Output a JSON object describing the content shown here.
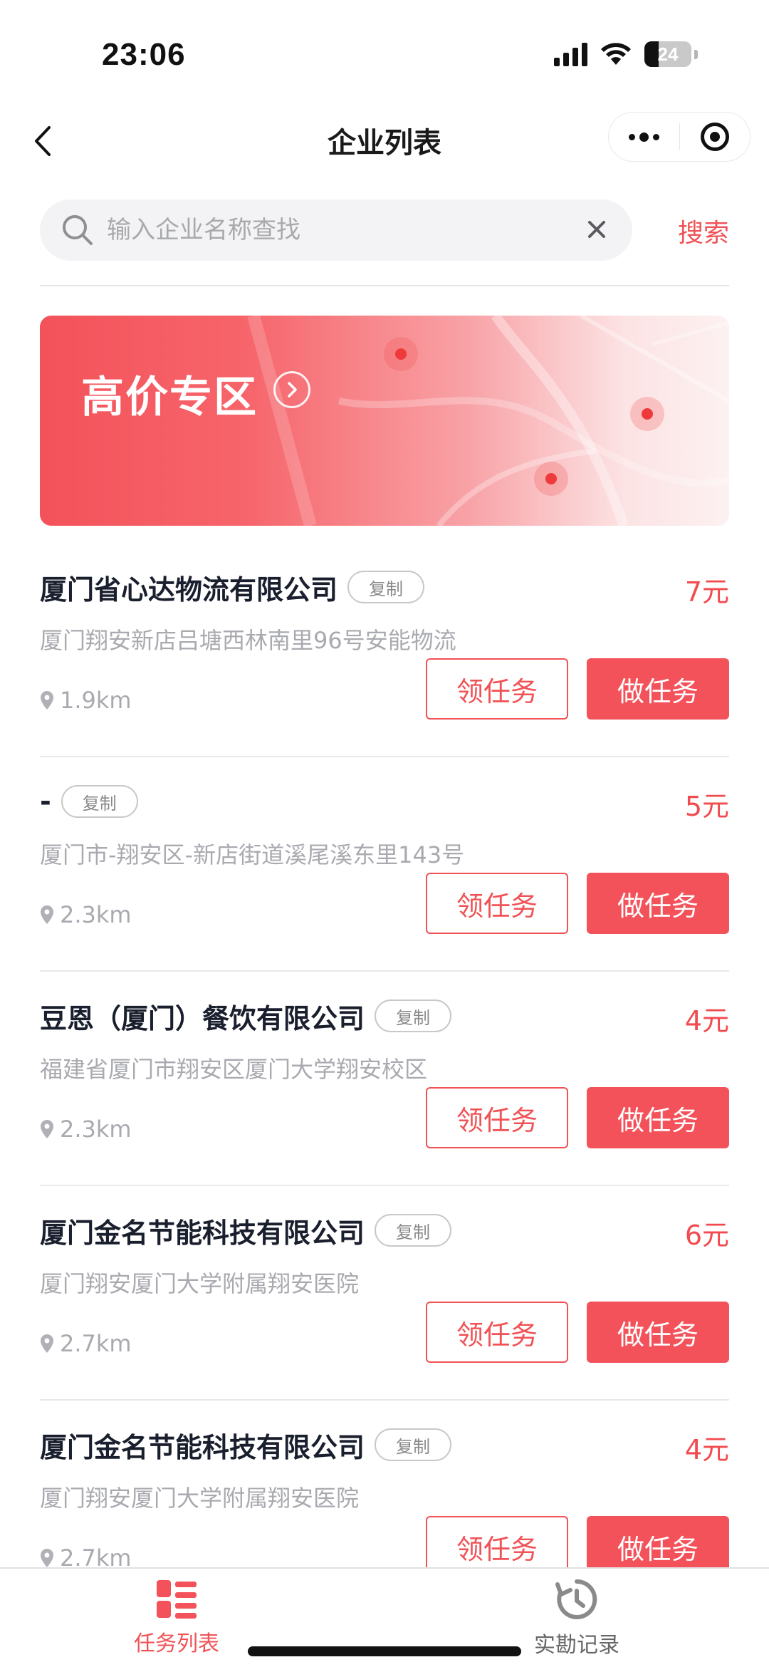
{
  "status_bar": {
    "time": "23:06",
    "battery": "24"
  },
  "nav": {
    "title": "企业列表"
  },
  "search": {
    "placeholder": "输入企业名称查找",
    "button_label": "搜索"
  },
  "banner": {
    "title": "高价专区"
  },
  "companies": [
    {
      "name": "厦门省心达物流有限公司",
      "copy_label": "复制",
      "price": "7元",
      "address": "厦门翔安新店吕塘西林南里96号安能物流",
      "distance": "1.9km",
      "claim_label": "领任务",
      "do_label": "做任务"
    },
    {
      "name": "-",
      "copy_label": "复制",
      "price": "5元",
      "address": "厦门市-翔安区-新店街道溪尾溪东里143号",
      "distance": "2.3km",
      "claim_label": "领任务",
      "do_label": "做任务"
    },
    {
      "name": "豆恩（厦门）餐饮有限公司",
      "copy_label": "复制",
      "price": "4元",
      "address": "福建省厦门市翔安区厦门大学翔安校区",
      "distance": "2.3km",
      "claim_label": "领任务",
      "do_label": "做任务"
    },
    {
      "name": "厦门金名节能科技有限公司",
      "copy_label": "复制",
      "price": "6元",
      "address": "厦门翔安厦门大学附属翔安医院",
      "distance": "2.7km",
      "claim_label": "领任务",
      "do_label": "做任务"
    },
    {
      "name": "厦门金名节能科技有限公司",
      "copy_label": "复制",
      "price": "4元",
      "address": "厦门翔安厦门大学附属翔安医院",
      "distance": "2.7km",
      "claim_label": "领任务",
      "do_label": "做任务"
    }
  ],
  "tabs": [
    {
      "label": "任务列表",
      "icon": "task-list-icon",
      "active": true
    },
    {
      "label": "实勘记录",
      "icon": "history-icon",
      "active": false
    }
  ],
  "colors": {
    "accent": "#f4525a",
    "text_primary": "#1a1f2e",
    "text_secondary": "#a9aab0"
  }
}
